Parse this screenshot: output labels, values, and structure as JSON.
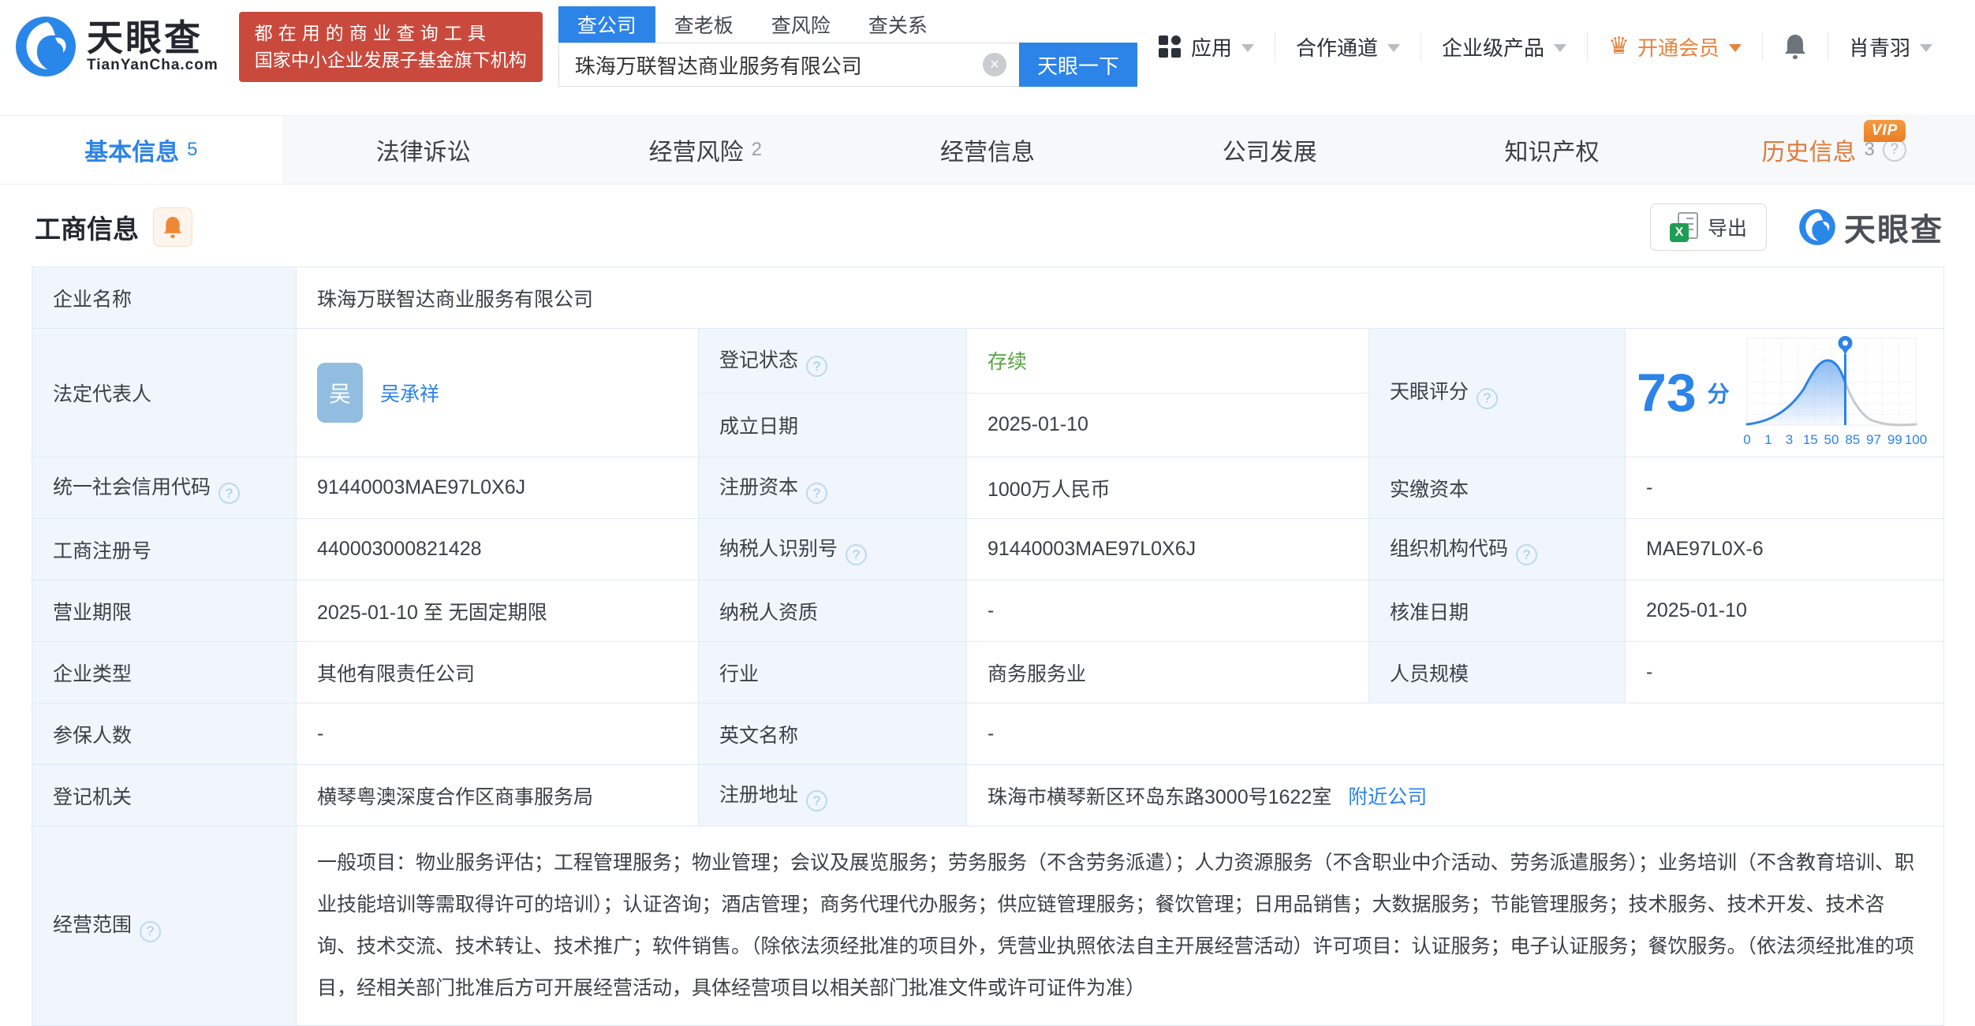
{
  "colors": {
    "accent": "#2c83e8",
    "status_green": "#57a33e",
    "vip_orange": "#e8823c",
    "badge_red": "#c94a3d"
  },
  "header": {
    "logo": {
      "brand": "天眼查",
      "domain": "TianYanCha.com"
    },
    "slogan": {
      "line1": "都在用的商业查询工具",
      "line2": "国家中小企业发展子基金旗下机构"
    },
    "search": {
      "tabs": [
        {
          "label": "查公司"
        },
        {
          "label": "查老板"
        },
        {
          "label": "查风险"
        },
        {
          "label": "查关系"
        }
      ],
      "value": "珠海万联智达商业服务有限公司",
      "clear_glyph": "×",
      "button": "天眼一下"
    },
    "nav": {
      "apps": "应用",
      "partner": "合作通道",
      "enterprise": "企业级产品",
      "member": "开通会员",
      "member_icon_glyph": "♛",
      "username": "肖青羽"
    }
  },
  "tabs": [
    {
      "label": "基本信息",
      "count": "5"
    },
    {
      "label": "法律诉讼"
    },
    {
      "label": "经营风险",
      "count": "2"
    },
    {
      "label": "经营信息"
    },
    {
      "label": "公司发展"
    },
    {
      "label": "知识产权"
    },
    {
      "label": "历史信息",
      "count": "3",
      "vip_label": "VIP"
    }
  ],
  "section": {
    "title": "工商信息",
    "export_label": "导出",
    "excel_glyph": "X",
    "watermark": "天眼查"
  },
  "table": {
    "company_name": {
      "label": "企业名称",
      "value": "珠海万联智达商业服务有限公司"
    },
    "legal_rep": {
      "label": "法定代表人",
      "avatar_char": "吴",
      "name": "吴承祥"
    },
    "reg_status": {
      "label": "登记状态",
      "value": "存续"
    },
    "establish_date": {
      "label": "成立日期",
      "value": "2025-01-10"
    },
    "tyc_score": {
      "label": "天眼评分"
    },
    "credit_code": {
      "label": "统一社会信用代码",
      "value": "91440003MAE97L0X6J"
    },
    "reg_capital": {
      "label": "注册资本",
      "value": "1000万人民币"
    },
    "paid_capital": {
      "label": "实缴资本",
      "value": "-"
    },
    "reg_number": {
      "label": "工商注册号",
      "value": "440003000821428"
    },
    "taxpayer_id": {
      "label": "纳税人识别号",
      "value": "91440003MAE97L0X6J"
    },
    "org_code": {
      "label": "组织机构代码",
      "value": "MAE97L0X-6"
    },
    "business_term": {
      "label": "营业期限",
      "value": "2025-01-10 至 无固定期限"
    },
    "taxpayer_quality": {
      "label": "纳税人资质",
      "value": "-"
    },
    "approval_date": {
      "label": "核准日期",
      "value": "2025-01-10"
    },
    "company_type": {
      "label": "企业类型",
      "value": "其他有限责任公司"
    },
    "industry": {
      "label": "行业",
      "value": "商务服务业"
    },
    "staff_size": {
      "label": "人员规模",
      "value": "-"
    },
    "insured_count": {
      "label": "参保人数",
      "value": "-"
    },
    "english_name": {
      "label": "英文名称",
      "value": "-"
    },
    "reg_authority": {
      "label": "登记机关",
      "value": "横琴粤澳深度合作区商事服务局"
    },
    "reg_address": {
      "label": "注册地址",
      "value": "珠海市横琴新区环岛东路3000号1622室",
      "link": "附近公司"
    },
    "business_scope": {
      "label": "经营范围",
      "value": "一般项目：物业服务评估；工程管理服务；物业管理；会议及展览服务；劳务服务（不含劳务派遣）；人力资源服务（不含职业中介活动、劳务派遣服务）；业务培训（不含教育培训、职业技能培训等需取得许可的培训）；认证咨询；酒店管理；商务代理代办服务；供应链管理服务；餐饮管理；日用品销售；大数据服务；节能管理服务；技术服务、技术开发、技术咨询、技术交流、技术转让、技术推广；软件销售。（除依法须经批准的项目外，凭营业执照依法自主开展经营活动）许可项目：认证服务；电子认证服务；餐饮服务。（依法须经批准的项目，经相关部门批准后方可开展经营活动，具体经营项目以相关部门批准文件或许可证件为准）"
    }
  },
  "chart_data": {
    "type": "area",
    "title": "天眼评分分布曲线",
    "score_value": "73",
    "score_unit": "分",
    "x_ticks": [
      "0",
      "1",
      "3",
      "15",
      "50",
      "85",
      "97",
      "99",
      "100"
    ],
    "marker_value": 73,
    "note": "bell curve, blue filled left of marker at 73, gray right, grid on"
  }
}
